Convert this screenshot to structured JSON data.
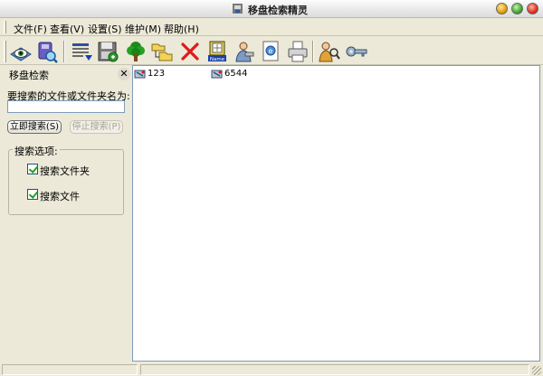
{
  "window": {
    "title": "移盘检索精灵"
  },
  "menu": [
    {
      "label": "文件(F)"
    },
    {
      "label": "查看(V)"
    },
    {
      "label": "设置(S)"
    },
    {
      "label": "维护(M)"
    },
    {
      "label": "帮助(H)"
    }
  ],
  "toolbar": [
    {
      "icon": "eye-view-icon"
    },
    {
      "icon": "disk-search-icon"
    },
    {
      "icon": "list-dropdown-icon"
    },
    {
      "icon": "floppy-add-icon"
    },
    {
      "icon": "tree-icon"
    },
    {
      "icon": "folder-tree-icon"
    },
    {
      "icon": "delete-x-icon"
    },
    {
      "icon": "rename-name-icon",
      "badge": "Name"
    },
    {
      "icon": "person-tool-icon"
    },
    {
      "icon": "web-page-icon"
    },
    {
      "icon": "printer-icon"
    },
    {
      "icon": "user-search-icon"
    },
    {
      "icon": "key-icon"
    }
  ],
  "search_panel": {
    "title": "移盘检索",
    "prompt": "要搜索的文件或文件夹名为:",
    "input_value": "",
    "start_button": "立即搜索(S)",
    "stop_button": "停止搜索(P)",
    "options": {
      "legend": "搜索选项:",
      "search_folders": {
        "label": "搜索文件夹",
        "checked": true
      },
      "search_files": {
        "label": "搜索文件",
        "checked": true
      }
    }
  },
  "files": [
    {
      "name": "123"
    },
    {
      "name": "6544"
    }
  ],
  "colors": {
    "accent_blue": "#1c5180",
    "delete_red": "#e0191c",
    "window_bg": "#ece9d8"
  }
}
